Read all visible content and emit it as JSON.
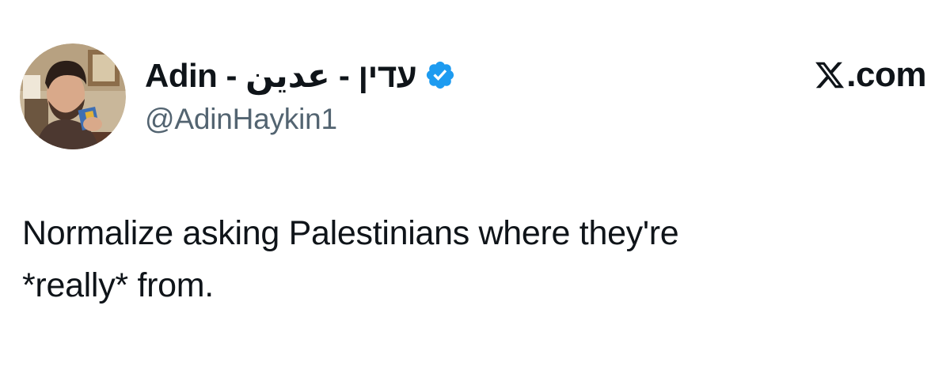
{
  "tweet": {
    "author": {
      "display_name": "Adin - עדין - عدين",
      "handle": "@AdinHaykin1",
      "verified": true,
      "verified_icon": "verified-badge-icon",
      "avatar_icon": "avatar-photo"
    },
    "brand": {
      "icon": "x-logo-icon",
      "label": ".com"
    },
    "text_lines": [
      "Normalize asking Palestinians where they're",
      "*really* from."
    ]
  },
  "colors": {
    "text_primary": "#0f1419",
    "text_secondary": "#536471",
    "verified_blue": "#1d9bf0",
    "background": "#ffffff"
  }
}
